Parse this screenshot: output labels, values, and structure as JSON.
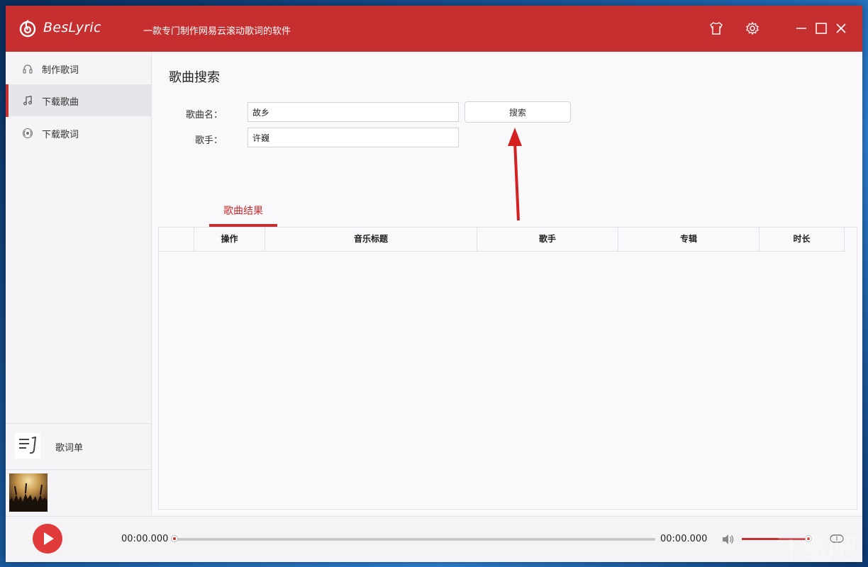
{
  "app": {
    "name": "BesLyric",
    "subtitle": "一款专门制作网易云滚动歌词的软件"
  },
  "sidebar": {
    "items": [
      {
        "label": "制作歌词",
        "icon": "headphones-icon",
        "active": false
      },
      {
        "label": "下载歌曲",
        "icon": "music-note-icon",
        "active": true
      },
      {
        "label": "下载歌词",
        "icon": "radio-icon",
        "active": false
      }
    ],
    "playlist_label": "歌词单"
  },
  "main": {
    "title": "歌曲搜索",
    "song_label": "歌曲名：",
    "song_value": "故乡",
    "artist_label": "歌手：",
    "artist_value": "许巍",
    "search_button": "搜索",
    "result_tab": "歌曲结果",
    "table": {
      "columns": [
        "操作",
        "音乐标题",
        "歌手",
        "专辑",
        "时长"
      ],
      "rows": []
    }
  },
  "player": {
    "current_time": "00:00.000",
    "total_time": "00:00.000",
    "progress": 0,
    "volume": 1.0
  },
  "colors": {
    "accent": "#c62f2f",
    "play": "#e03a3a",
    "annotation_arrow": "#d42020"
  },
  "watermark": "下载吧"
}
